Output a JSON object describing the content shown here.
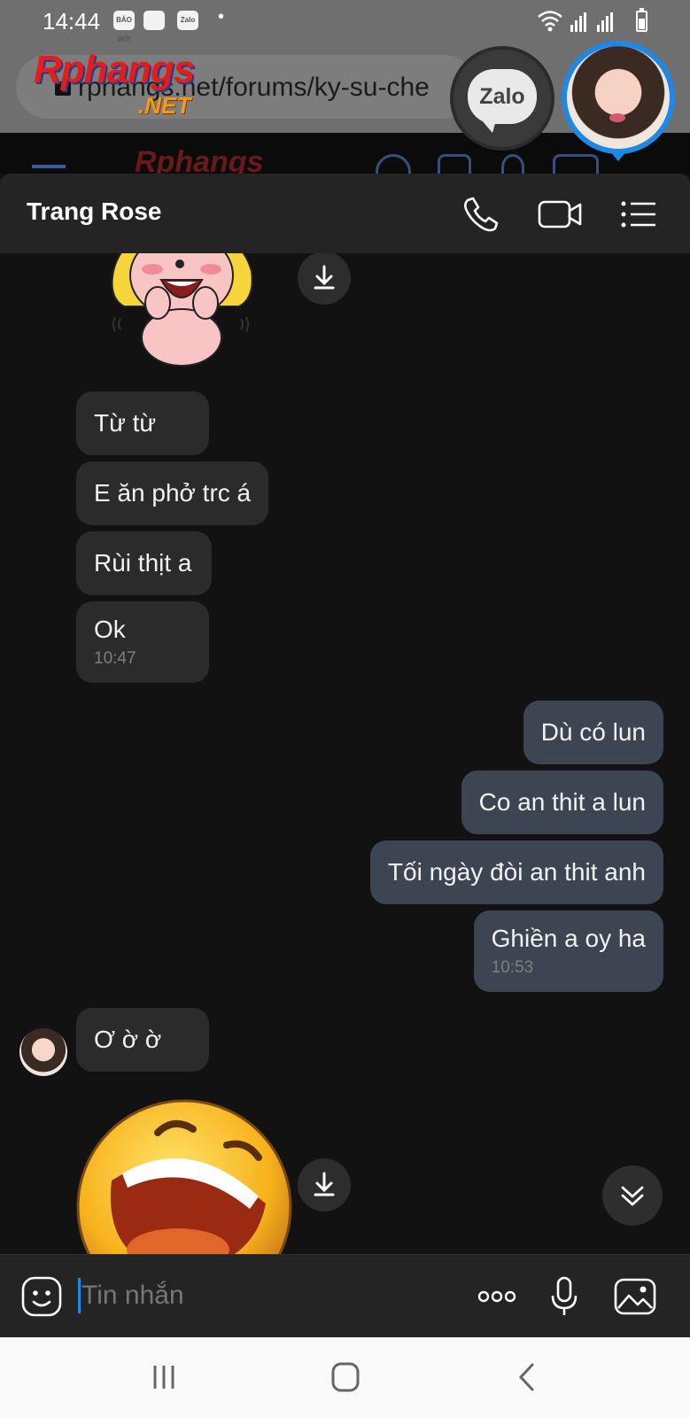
{
  "status_bar": {
    "time": "14:44",
    "notif_icons": [
      "BÁO MỚI",
      "",
      "Zalo"
    ],
    "dot": "•"
  },
  "browser": {
    "url": "rphangs.net/forums/ky-su-che",
    "logo_main": "Rphangs",
    "logo_sub": ".NET",
    "site_logo_faded": "Rphangs"
  },
  "floating_heads": {
    "zalo_label": "Zalo"
  },
  "chat": {
    "contact_name": "Trang Rose",
    "incoming": [
      {
        "text": "Từ từ"
      },
      {
        "text": "E ăn phở trc á"
      },
      {
        "text": "Rùi thịt a"
      },
      {
        "text": "Ok",
        "time": "10:47"
      },
      {
        "text": "Ơ ờ ờ"
      }
    ],
    "outgoing": [
      {
        "text": "Dù có lun"
      },
      {
        "text": "Co an thit a lun"
      },
      {
        "text": "Tối ngày đòi an thit anh"
      },
      {
        "text": "Ghiền a oy ha",
        "time": "10:53"
      }
    ]
  },
  "input": {
    "placeholder": "Tin nhắn"
  },
  "colors": {
    "accent": "#1e88e5",
    "incoming_bubble": "#2b2b2b",
    "outgoing_bubble": "#3d4452",
    "background": "#121212",
    "header": "#242424"
  }
}
